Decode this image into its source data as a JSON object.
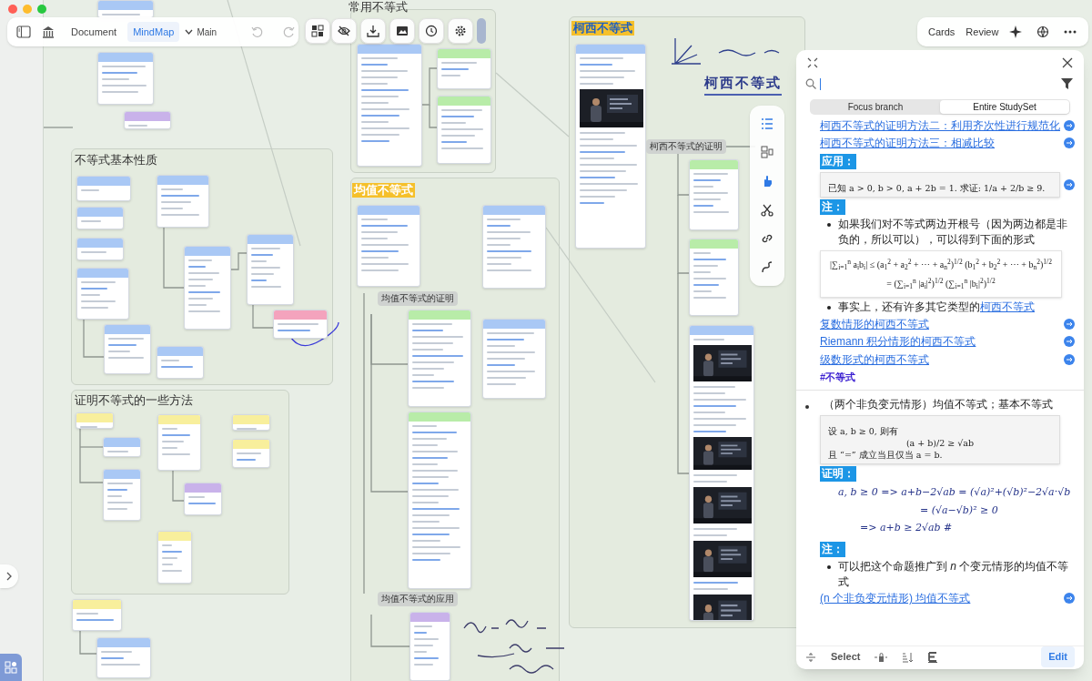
{
  "toolbar": {
    "views": [
      {
        "label": "Document",
        "selected": false
      },
      {
        "label": "MindMap",
        "selected": true
      }
    ],
    "branch": "Main"
  },
  "top_right": {
    "buttons": [
      "Cards",
      "Review"
    ]
  },
  "canvas": {
    "sections": [
      {
        "title": "常用不等式",
        "kind": "plain"
      },
      {
        "title": "不等式基本性质",
        "kind": "plain"
      },
      {
        "title": "证明不等式的一些方法",
        "kind": "plain"
      },
      {
        "title": "均值不等式",
        "kind": "highlight"
      },
      {
        "title": "柯西不等式",
        "kind": "highlight-link"
      }
    ],
    "nodes": [
      {
        "label": "柯西不等式的证明"
      },
      {
        "label": "均值不等式的证明"
      },
      {
        "label": "均值不等式的应用"
      }
    ],
    "handwritten_title": "柯西不等式",
    "cards": [
      {
        "color": "#a9c8f5"
      },
      {
        "color": "#a9c8f5"
      },
      {
        "color": "#a9c8f5"
      },
      {
        "color": "#a9c8f5"
      },
      {
        "color": "#a9c8f5"
      },
      {
        "color": "#a9c8f5"
      },
      {
        "color": "#a9c8f5"
      },
      {
        "color": "#a9c8f5"
      },
      {
        "color": "#f4a3bd"
      },
      {
        "color": "#a9c8f5"
      },
      {
        "color": "#f8ef9c"
      },
      {
        "color": "#a9c8f5"
      },
      {
        "color": "#a9c8f5"
      },
      {
        "color": "#f8ef9c"
      },
      {
        "color": "#c9b2ea"
      },
      {
        "color": "#f8ef9c"
      },
      {
        "color": "#f8ef9c"
      },
      {
        "color": "#f8ef9c"
      },
      {
        "color": "#f8ef9c"
      },
      {
        "color": "#a9c8f5"
      },
      {
        "color": "#a9c8f5"
      },
      {
        "color": "#a9c8f5"
      },
      {
        "color": "#c9b2ea"
      },
      {
        "color": "#a9c8f5"
      },
      {
        "color": "#b8eca8"
      },
      {
        "color": "#b8eca8"
      },
      {
        "color": "#a9c8f5"
      },
      {
        "color": "#a9c8f5"
      },
      {
        "color": "#b8eca8"
      },
      {
        "color": "#a9c8f5"
      },
      {
        "color": "#b8eca8"
      },
      {
        "color": "#c9b2ea"
      },
      {
        "color": "#a9c8f5"
      },
      {
        "color": "#b8eca8"
      },
      {
        "color": "#b8eca8"
      },
      {
        "color": "#a9c8f5"
      }
    ]
  },
  "panel": {
    "scopes": [
      {
        "label": "Focus branch",
        "selected": false
      },
      {
        "label": "Entire StudySet",
        "selected": true
      }
    ],
    "entries": [
      {
        "kind": "link",
        "text": "柯西不等式的证明方法二：利用齐次性进行规范化"
      },
      {
        "kind": "link",
        "text": "柯西不等式的证明方法三：相减比较"
      },
      {
        "kind": "heading",
        "text": "应用："
      },
      {
        "kind": "card",
        "lines": [
          "已知 a > 0, b > 0, a + 2b = 1. 求证: 1/a + 2/b ≥ 9."
        ]
      },
      {
        "kind": "heading",
        "text": "注："
      },
      {
        "kind": "bullet",
        "text": "如果我们对不等式两边开根号（因为两边都是非负的，所以可以），可以得到下面的形式"
      },
      {
        "kind": "formula",
        "lines": [
          "|∑$_{i=1}$$^{n}$ a$_{i}$b$_{i}$| ≤ (a$_{1}$$^{2}$ + a$_{2}$$^{2}$ + ⋯ + a$_{n}$$^{2}$)$^{1/2}$ (b$_{1}$$^{2}$ + b$_{2}$$^{2}$ + ⋯ + b$_{n}$$^{2}$)$^{1/2}$",
          "= (∑$_{i=1}$$^{n}$ |a$_{i}$|$^{2}$)$^{1/2}$ (∑$_{i=1}$$^{n}$ |b$_{i}$|$^{2}$)$^{1/2}$"
        ]
      },
      {
        "kind": "bullet",
        "text": "事实上，还有许多其它类型的",
        "link": "柯西不等式"
      },
      {
        "kind": "link",
        "text": "复数情形的柯西不等式"
      },
      {
        "kind": "link",
        "text": "Riemann 积分情形的柯西不等式"
      },
      {
        "kind": "link",
        "text": "级数形式的柯西不等式"
      },
      {
        "kind": "tag",
        "text": "#不等式"
      },
      {
        "kind": "item",
        "text": "（两个非负变元情形）均值不等式；基本不等式"
      },
      {
        "kind": "card",
        "lines": [
          "设 a, b ≥ 0, 则有",
          "(a + b)/2 ≥ √ab",
          "且 “=” 成立当且仅当 a = b."
        ]
      },
      {
        "kind": "heading",
        "text": "证明："
      },
      {
        "kind": "handwriting",
        "lines": [
          "a, b ≥ 0 => a+b−2√ab = (√a)²+(√b)²−2√a·√b",
          "= (√a−√b)² ≥ 0",
          "=> a+b ≥ 2√ab #"
        ]
      },
      {
        "kind": "heading",
        "text": "注："
      },
      {
        "kind": "bullet",
        "text": "可以把这个命题推广到 *n* 个变元情形的均值不等式"
      },
      {
        "kind": "link",
        "text": "(n 个非负变元情形) 均值不等式"
      }
    ],
    "footer": {
      "select": "Select",
      "edit": "Edit"
    }
  }
}
